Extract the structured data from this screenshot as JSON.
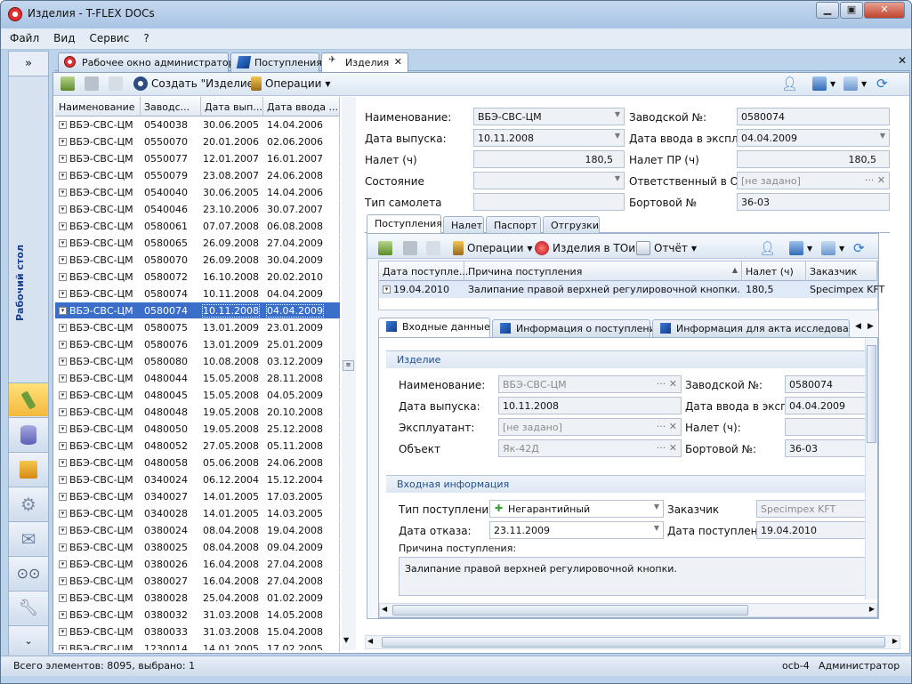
{
  "window": {
    "title": "Изделия - T-FLEX DOCs"
  },
  "menu": [
    "Файл",
    "Вид",
    "Сервис",
    "?"
  ],
  "nav": {
    "collapse": "»",
    "desk_label": "Рабочий стол",
    "expand": "⌄"
  },
  "doc_tabs": [
    {
      "label": "Рабочее окно администратора",
      "icon": "tflex-logo-icon"
    },
    {
      "label": "Поступления",
      "icon": "blue-book-icon"
    },
    {
      "label": "Изделия",
      "icon": "aircraft-icon"
    }
  ],
  "toolbar": {
    "create_label": "Создать \"Изделие\"",
    "operations_label": "Операции"
  },
  "list": {
    "headers": [
      "Наименование",
      "Заводс...",
      "Дата вып...",
      "Дата ввода ..."
    ],
    "selected_index": 11,
    "rows": [
      [
        "ВБЭ-СВС-ЦМ",
        "0540038",
        "30.06.2005",
        "14.04.2006"
      ],
      [
        "ВБЭ-СВС-ЦМ",
        "0550070",
        "20.01.2006",
        "02.06.2006"
      ],
      [
        "ВБЭ-СВС-ЦМ",
        "0550077",
        "12.01.2007",
        "16.01.2007"
      ],
      [
        "ВБЭ-СВС-ЦМ",
        "0550079",
        "23.08.2007",
        "24.06.2008"
      ],
      [
        "ВБЭ-СВС-ЦМ",
        "0540040",
        "30.06.2005",
        "14.04.2006"
      ],
      [
        "ВБЭ-СВС-ЦМ",
        "0540046",
        "23.10.2006",
        "30.07.2007"
      ],
      [
        "ВБЭ-СВС-ЦМ",
        "0580061",
        "07.07.2008",
        "06.08.2008"
      ],
      [
        "ВБЭ-СВС-ЦМ",
        "0580065",
        "26.09.2008",
        "27.04.2009"
      ],
      [
        "ВБЭ-СВС-ЦМ",
        "0580070",
        "26.09.2008",
        "30.04.2009"
      ],
      [
        "ВБЭ-СВС-ЦМ",
        "0580072",
        "16.10.2008",
        "20.02.2010"
      ],
      [
        "ВБЭ-СВС-ЦМ",
        "0580074",
        "10.11.2008",
        "04.04.2009"
      ],
      [
        "ВБЭ-СВС-ЦМ",
        "0580074",
        "10.11.2008",
        "04.04.2009"
      ],
      [
        "ВБЭ-СВС-ЦМ",
        "0580075",
        "13.01.2009",
        "23.01.2009"
      ],
      [
        "ВБЭ-СВС-ЦМ",
        "0580076",
        "13.01.2009",
        "25.01.2009"
      ],
      [
        "ВБЭ-СВС-ЦМ",
        "0580080",
        "10.08.2008",
        "03.12.2009"
      ],
      [
        "ВБЭ-СВС-ЦМ",
        "0480044",
        "15.05.2008",
        "28.11.2008"
      ],
      [
        "ВБЭ-СВС-ЦМ",
        "0480045",
        "15.05.2008",
        "04.05.2009"
      ],
      [
        "ВБЭ-СВС-ЦМ",
        "0480048",
        "19.05.2008",
        "20.10.2008"
      ],
      [
        "ВБЭ-СВС-ЦМ",
        "0480050",
        "19.05.2008",
        "25.12.2008"
      ],
      [
        "ВБЭ-СВС-ЦМ",
        "0480052",
        "27.05.2008",
        "05.11.2008"
      ],
      [
        "ВБЭ-СВС-ЦМ",
        "0480058",
        "05.06.2008",
        "24.06.2008"
      ],
      [
        "ВБЭ-СВС-ЦМ",
        "0340024",
        "06.12.2004",
        "15.12.2004"
      ],
      [
        "ВБЭ-СВС-ЦМ",
        "0340027",
        "14.01.2005",
        "17.03.2005"
      ],
      [
        "ВБЭ-СВС-ЦМ",
        "0340028",
        "14.01.2005",
        "14.03.2005"
      ],
      [
        "ВБЭ-СВС-ЦМ",
        "0380024",
        "08.04.2008",
        "19.04.2008"
      ],
      [
        "ВБЭ-СВС-ЦМ",
        "0380025",
        "08.04.2008",
        "09.04.2009"
      ],
      [
        "ВБЭ-СВС-ЦМ",
        "0380026",
        "16.04.2008",
        "27.04.2008"
      ],
      [
        "ВБЭ-СВС-ЦМ",
        "0380027",
        "16.04.2008",
        "27.04.2008"
      ],
      [
        "ВБЭ-СВС-ЦМ",
        "0380028",
        "25.04.2008",
        "01.02.2009"
      ],
      [
        "ВБЭ-СВС-ЦМ",
        "0380032",
        "31.03.2008",
        "14.05.2008"
      ],
      [
        "ВБЭ-СВС-ЦМ",
        "0380033",
        "31.03.2008",
        "15.04.2008"
      ],
      [
        "ВБЭ-СВС-ЦМ",
        "1230014",
        "14.01.2005",
        "17.02.2005"
      ]
    ]
  },
  "detail": {
    "name_label": "Наименование:",
    "name_value": "ВБЭ-СВС-ЦМ",
    "factory_label": "Заводской №:",
    "factory_value": "0580074",
    "release_label": "Дата выпуска:",
    "release_value": "10.11.2008",
    "commission_label": "Дата ввода в экспл.:",
    "commission_value": "04.04.2009",
    "flight_label": "Налет (ч)",
    "flight_value": "180,5",
    "flight_pr_label": "Налет ПР (ч)",
    "flight_pr_value": "180,5",
    "state_label": "Состояние",
    "state_value": "",
    "responsible_label": "Ответственный в ОЛП:",
    "responsible_value": "[не задано]",
    "aircraft_type_label": "Тип самолета",
    "aircraft_type_value": "",
    "board_label": "Бортовой №",
    "board_value": "36-03"
  },
  "detail_tabs": [
    "Поступления",
    "Налет",
    "Паспорт",
    "Отгрузки"
  ],
  "sub_toolbar": {
    "operations": "Операции",
    "repairs": "Изделия в ТОиР",
    "report": "Отчёт"
  },
  "receipts": {
    "headers": [
      "Дата поступле...",
      "Причина поступления",
      "Налет (ч)",
      "Заказчик"
    ],
    "row": [
      "19.04.2010",
      "Залипание правой верхней регулировочной кнопки.",
      "180,5",
      "Specimpex KFT"
    ]
  },
  "info_tabs": [
    "Входные данные",
    "Информация о поступлении",
    "Информация для акта исследования"
  ],
  "product_section": {
    "title": "Изделие",
    "name_label": "Наименование:",
    "name_value": "ВБЭ-СВС-ЦМ",
    "factory_label": "Заводской №:",
    "factory_value": "0580074",
    "release_label": "Дата выпуска:",
    "release_value": "10.11.2008",
    "commission_label": "Дата ввода в экспл.:",
    "commission_value": "04.04.2009",
    "operator_label": "Эксплуатант:",
    "operator_value": "[не задано]",
    "flight_label": "Налет (ч):",
    "flight_value": "",
    "object_label": "Объект",
    "object_value": "Як-42Д",
    "board_label": "Бортовой №:",
    "board_value": "36-03"
  },
  "input_section": {
    "title": "Входная информация",
    "type_label": "Тип поступления:",
    "type_value": "Негарантийный",
    "customer_label": "Заказчик",
    "customer_value": "Specimpex KFT",
    "failure_label": "Дата отказа:",
    "failure_value": "23.11.2009",
    "receipt_date_label": "Дата поступления:",
    "receipt_date_value": "19.04.2010",
    "reason_label": "Причина поступления:",
    "reason_value": "Залипание правой верхней регулировочной кнопки."
  },
  "status": {
    "count": "Всего элементов: 8095, выбрано: 1",
    "server": "ocb-4",
    "user": "Администратор"
  },
  "colors": {
    "selection": "#3a6ec9",
    "frame": "#bcd3ec",
    "section_title": "#1f4f92"
  }
}
